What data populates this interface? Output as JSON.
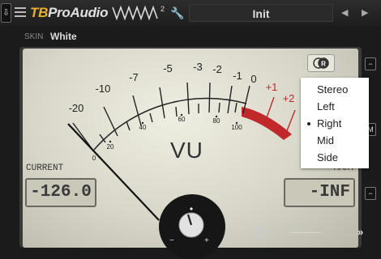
{
  "header": {
    "menu_icon": "down-arrow-icon",
    "brand_tb": "TB",
    "brand_rest": "ProAudio",
    "wave_superscript": "2",
    "preset_name": "Init",
    "prev_icon": "triangle-left-icon",
    "next_icon": "triangle-right-icon"
  },
  "skin": {
    "label": "SKIN",
    "value": "White"
  },
  "side_buttons": {
    "top": "−",
    "middle": "M",
    "bottom": "−"
  },
  "meter": {
    "title": "VU",
    "scale_labels": [
      "-20",
      "-10",
      "-7",
      "-5",
      "-3",
      "-2",
      "-1",
      "0",
      "+1",
      "+2"
    ],
    "percent_labels": [
      "0",
      "20",
      "40",
      "60",
      "80",
      "100"
    ],
    "current_label": "CURRENT",
    "current_value": "-126.0",
    "max_label": "MAX.",
    "max_value": "-INF",
    "accent_red": "#c0282b"
  },
  "channel_menu": {
    "options": [
      "Stereo",
      "Left",
      "Right",
      "Mid",
      "Side"
    ],
    "selected": "Right"
  },
  "bottom": {
    "minus": "−",
    "plus": "+",
    "dashes": "----------",
    "forward": "»"
  }
}
